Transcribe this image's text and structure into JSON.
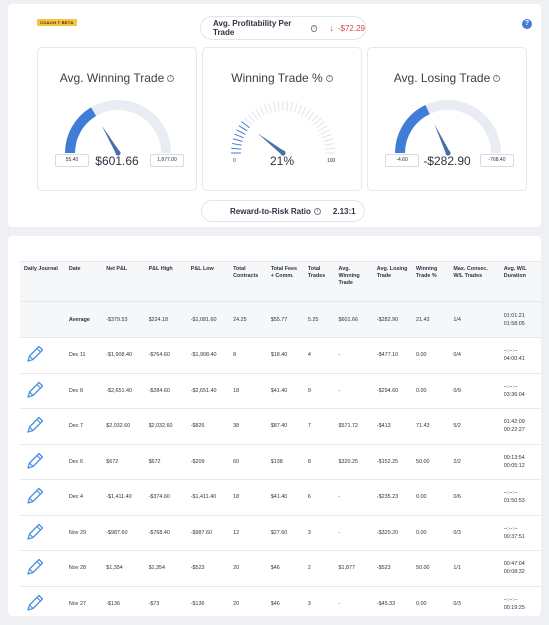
{
  "header": {
    "badge": "COACH T BETA",
    "help_icon": "?",
    "profitability_label": "Avg. Profitability Per Trade",
    "profitability_value": "-$72.29",
    "profitability_icon": "down-arrow-icon",
    "reward_risk_label": "Reward-to-Risk Ratio",
    "reward_risk_value": "2.13:1"
  },
  "colors": {
    "accent": "#3f7dd6",
    "gauge_track": "#e9edf3",
    "negative": "#d8463f",
    "badge": "#f5c242"
  },
  "cards": [
    {
      "title": "Avg. Winning Trade",
      "value": "$601.66",
      "min": "55.40",
      "max": "1,877.00",
      "fill": 0.33
    },
    {
      "title": "Winning Trade %",
      "value": "21%",
      "min": "0",
      "max": "100",
      "fill": 0.21
    },
    {
      "title": "Avg. Losing Trade",
      "value": "-$282.90",
      "min": "-4.60",
      "max": "-768.40",
      "fill": 0.36
    }
  ],
  "table": {
    "columns": [
      "Daily Journal",
      "Date",
      "Net P&L",
      "P&L High",
      "P&L Low",
      "Total Contracts",
      "Total Fees + Comm.",
      "Total Trades",
      "Avg. Winning Trade",
      "Avg. Losing Trade",
      "Winning Trade %",
      "Max. Consec. W/L Trades",
      "Avg. W/L Duration"
    ],
    "average": {
      "label": "Average",
      "net": "-$379.53",
      "high": "$224.18",
      "low": "-$1,081.60",
      "contracts": "24.25",
      "fees": "$55.77",
      "trades": "5.25",
      "avg_win": "$601.66",
      "avg_loss": "-$282.90",
      "win_pct": "21.43",
      "consec": "1/4",
      "dur_w": "01:01:21",
      "dur_l": "01:58:05"
    },
    "rows": [
      {
        "date": "Dec 11",
        "net": "-$1,908.40",
        "high": "-$764.60",
        "low": "-$1,908.40",
        "contracts": "8",
        "fees": "$18.40",
        "trades": "4",
        "avg_win": "-",
        "avg_loss": "-$477.10",
        "win_pct": "0.00",
        "consec": "0/4",
        "dur_w": "--:--:--",
        "dur_l": "04:00:41"
      },
      {
        "date": "Dec 8",
        "net": "-$2,651.40",
        "high": "-$284.60",
        "low": "-$2,651.40",
        "contracts": "18",
        "fees": "$41.40",
        "trades": "9",
        "avg_win": "-",
        "avg_loss": "-$294.60",
        "win_pct": "0.00",
        "consec": "0/9",
        "dur_w": "--:--:--",
        "dur_l": "03:36:04"
      },
      {
        "date": "Dec 7",
        "net": "$2,032.60",
        "high": "$2,032.60",
        "low": "-$826",
        "contracts": "38",
        "fees": "$87.40",
        "trades": "7",
        "avg_win": "$571.72",
        "avg_loss": "-$413",
        "win_pct": "71.43",
        "consec": "5/2",
        "dur_w": "01:42:09",
        "dur_l": "00:22:27"
      },
      {
        "date": "Dec 6",
        "net": "$672",
        "high": "$672",
        "low": "-$209",
        "contracts": "60",
        "fees": "$138",
        "trades": "8",
        "avg_win": "$320.25",
        "avg_loss": "-$152.25",
        "win_pct": "50.00",
        "consec": "2/2",
        "dur_w": "00:13:54",
        "dur_l": "00:05:12"
      },
      {
        "date": "Dec 4",
        "net": "-$1,411.40",
        "high": "-$374.60",
        "low": "-$1,411.40",
        "contracts": "18",
        "fees": "$41.40",
        "trades": "6",
        "avg_win": "-",
        "avg_loss": "-$235.23",
        "win_pct": "0.00",
        "consec": "0/6",
        "dur_w": "--:--:--",
        "dur_l": "01:50:53"
      },
      {
        "date": "Nov 29",
        "net": "-$987.60",
        "high": "-$768.40",
        "low": "-$987.60",
        "contracts": "12",
        "fees": "$27.60",
        "trades": "3",
        "avg_win": "-",
        "avg_loss": "-$329.20",
        "win_pct": "0.00",
        "consec": "0/3",
        "dur_w": "--:--:--",
        "dur_l": "00:37:51"
      },
      {
        "date": "Nov 28",
        "net": "$1,354",
        "high": "$1,354",
        "low": "-$523",
        "contracts": "20",
        "fees": "$46",
        "trades": "2",
        "avg_win": "$1,877",
        "avg_loss": "-$523",
        "win_pct": "50.00",
        "consec": "1/1",
        "dur_w": "00:47:04",
        "dur_l": "00:08:32"
      },
      {
        "date": "Nov 27",
        "net": "-$136",
        "high": "-$73",
        "low": "-$136",
        "contracts": "20",
        "fees": "$46",
        "trades": "3",
        "avg_win": "-",
        "avg_loss": "-$45.33",
        "win_pct": "0.00",
        "consec": "0/3",
        "dur_w": "--:--:--",
        "dur_l": "00:19:25"
      }
    ]
  }
}
